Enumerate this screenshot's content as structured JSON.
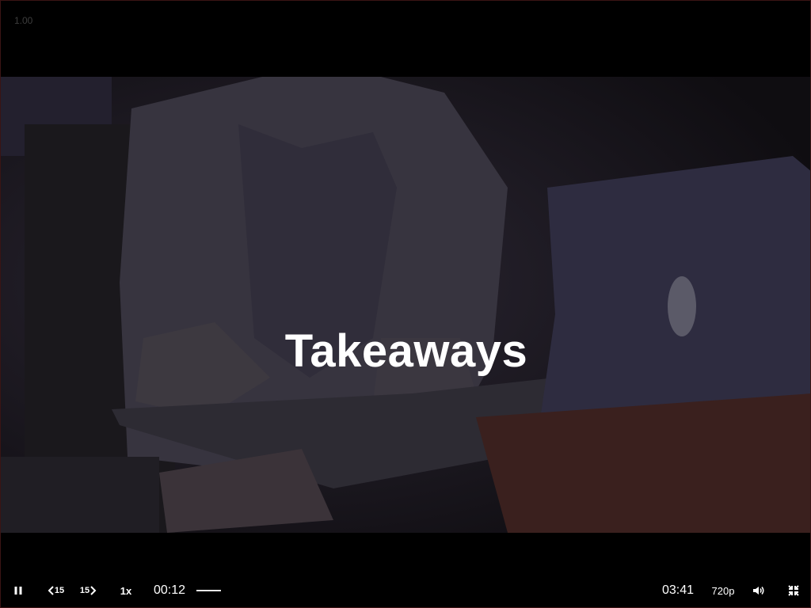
{
  "player": {
    "version_label": "1.00",
    "slide_title": "Takeaways"
  },
  "controls": {
    "play_state": "playing",
    "pause_icon": "pause-icon",
    "skip_back_label": "15",
    "skip_back_icon": "chevron-left-icon",
    "skip_forward_label": "15",
    "skip_forward_icon": "chevron-right-icon",
    "playback_rate": "1x",
    "current_time": "00:12",
    "duration": "03:41",
    "progress_fraction": 0.054,
    "quality": "720p",
    "volume_icon": "volume-icon",
    "fullscreen_icon": "exit-fullscreen-icon"
  },
  "colors": {
    "background": "#000000",
    "text": "#ffffff",
    "progress": "#e8e8e8"
  }
}
